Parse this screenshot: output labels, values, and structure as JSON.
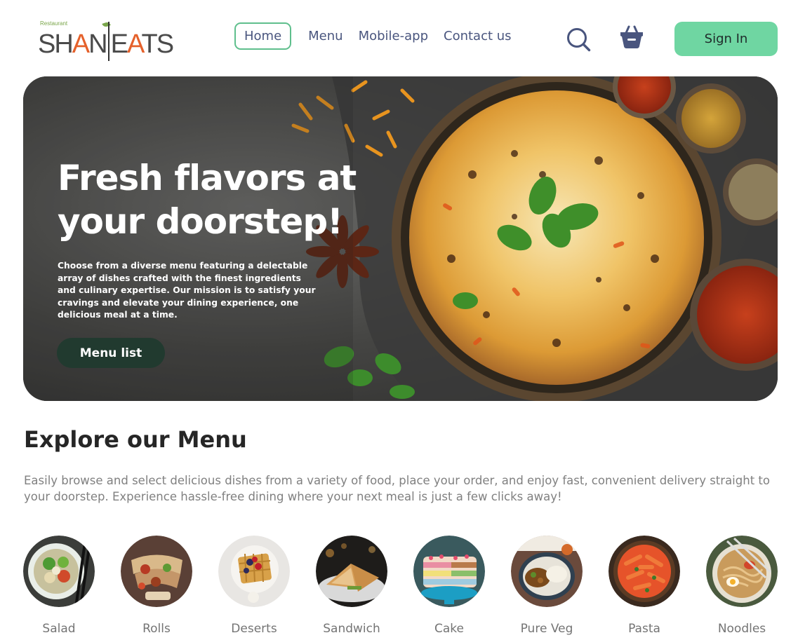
{
  "brand": {
    "small_label": "Restaurant",
    "name_part1": "SH",
    "name_accent1": "A",
    "name_part2": "N",
    "name_part3": "E",
    "name_accent2": "A",
    "name_part4": "TS"
  },
  "nav": {
    "items": [
      {
        "label": "Home",
        "active": true
      },
      {
        "label": "Menu",
        "active": false
      },
      {
        "label": "Mobile-app",
        "active": false
      },
      {
        "label": "Contact us",
        "active": false
      }
    ],
    "icons": [
      "search-icon",
      "basket-icon"
    ],
    "sign_in_label": "Sign In"
  },
  "colors": {
    "accent_green": "#6fd6a2",
    "active_border": "#5fbf8d",
    "nav_text": "#49557e",
    "hero_button": "#213a2f",
    "brand_orange": "#e5612b"
  },
  "hero": {
    "title": "Fresh flavors at your doorstep!",
    "text": "Choose from a diverse menu featuring a delectable array of dishes crafted with the finest ingredients and culinary expertise. Our mission is to satisfy your cravings and elevate your dining experience, one delicious meal at a time.",
    "button_label": "Menu list"
  },
  "explore": {
    "title": "Explore our Menu",
    "text": "Easily browse and select delicious dishes from a variety of food, place your order, and enjoy fast, convenient delivery straight to your doorstep. Experience hassle-free dining where your next meal is just a few clicks away!",
    "categories": [
      {
        "label": "Salad"
      },
      {
        "label": "Rolls"
      },
      {
        "label": "Deserts"
      },
      {
        "label": "Sandwich"
      },
      {
        "label": "Cake"
      },
      {
        "label": "Pure Veg"
      },
      {
        "label": "Pasta"
      },
      {
        "label": "Noodles"
      }
    ]
  }
}
